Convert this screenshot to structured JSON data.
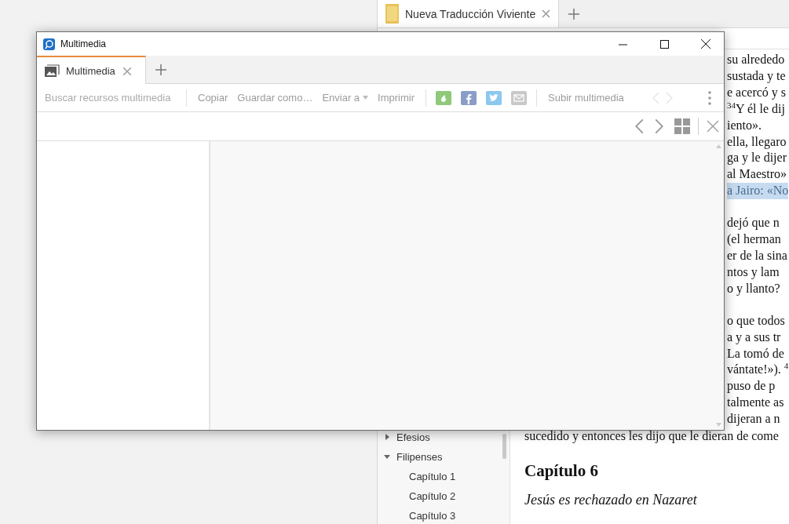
{
  "reader_app": {
    "tabs": [
      {
        "label": "Nueva Traducción Viviente",
        "selected": true
      }
    ],
    "sidebar": {
      "items": [
        {
          "label": "Efesios",
          "expanded": false
        },
        {
          "label": "Filipenses",
          "expanded": true,
          "children": [
            {
              "label": "Capítulo 1"
            },
            {
              "label": "Capítulo 2"
            },
            {
              "label": "Capítulo 3"
            }
          ]
        }
      ]
    },
    "covered_paragraphs": [
      [
        {
          "text": "su alrededo",
          "highlighted": false
        },
        {
          "text": "sustada y te",
          "highlighted": false
        },
        {
          "text": "e acercó y s",
          "highlighted": false
        },
        {
          "text": "$^{34}$Y él le dij",
          "highlighted": false
        },
        {
          "text": "iento».",
          "highlighted": false
        },
        {
          "text": "ella, llegaro",
          "highlighted": false
        },
        {
          "text": "ga y le dijer",
          "highlighted": false
        },
        {
          "text": "al Maestro»",
          "highlighted": false
        },
        {
          "text": "a Jairo: «No",
          "highlighted": true
        }
      ],
      [
        {
          "text": "dejó que n",
          "highlighted": false
        },
        {
          "text": "(el herman",
          "highlighted": false
        },
        {
          "text": "er de la sina",
          "highlighted": false
        },
        {
          "text": "ntos y lam",
          "highlighted": false
        },
        {
          "text": "o y llanto?",
          "highlighted": false
        }
      ],
      [
        {
          "text": "o que todos",
          "highlighted": false
        },
        {
          "text": "a y a sus tr",
          "highlighted": false
        },
        {
          "text": "La tomó de",
          "highlighted": false
        },
        {
          "text": "vántate!»). $^{4}$",
          "highlighted": false
        },
        {
          "text": "puso de p",
          "highlighted": false
        },
        {
          "text": "talmente as",
          "highlighted": false
        },
        {
          "text": "dijeran a n",
          "highlighted": false
        }
      ]
    ],
    "line": "sucedido y entonces les dijo que le dieran de come",
    "heading": "Capítulo 6",
    "subheading": "Jesús es rechazado en Nazaret"
  },
  "window": {
    "title": "Multimedia",
    "tabs": [
      {
        "label": "Multimedia",
        "selected": true
      }
    ],
    "toolbar": {
      "search": {
        "placeholder": "Buscar recursos multimedia"
      },
      "actions": [
        {
          "label": "Copiar",
          "dropdown": false
        },
        {
          "label": "Guardar como…",
          "dropdown": false
        },
        {
          "label": "Enviar a",
          "dropdown": true
        },
        {
          "label": "Imprimir",
          "dropdown": false
        }
      ],
      "share": [
        {
          "kind": "evernote",
          "color": "#8fc97a"
        },
        {
          "kind": "facebook",
          "color": "#8a9dc6"
        },
        {
          "kind": "twitter",
          "color": "#8cc8ee"
        },
        {
          "kind": "mail",
          "color": "#c8c8c8"
        }
      ],
      "upload": "Subir multimedia",
      "pager_disabled": true
    },
    "viewer_nav_disabled": false
  }
}
